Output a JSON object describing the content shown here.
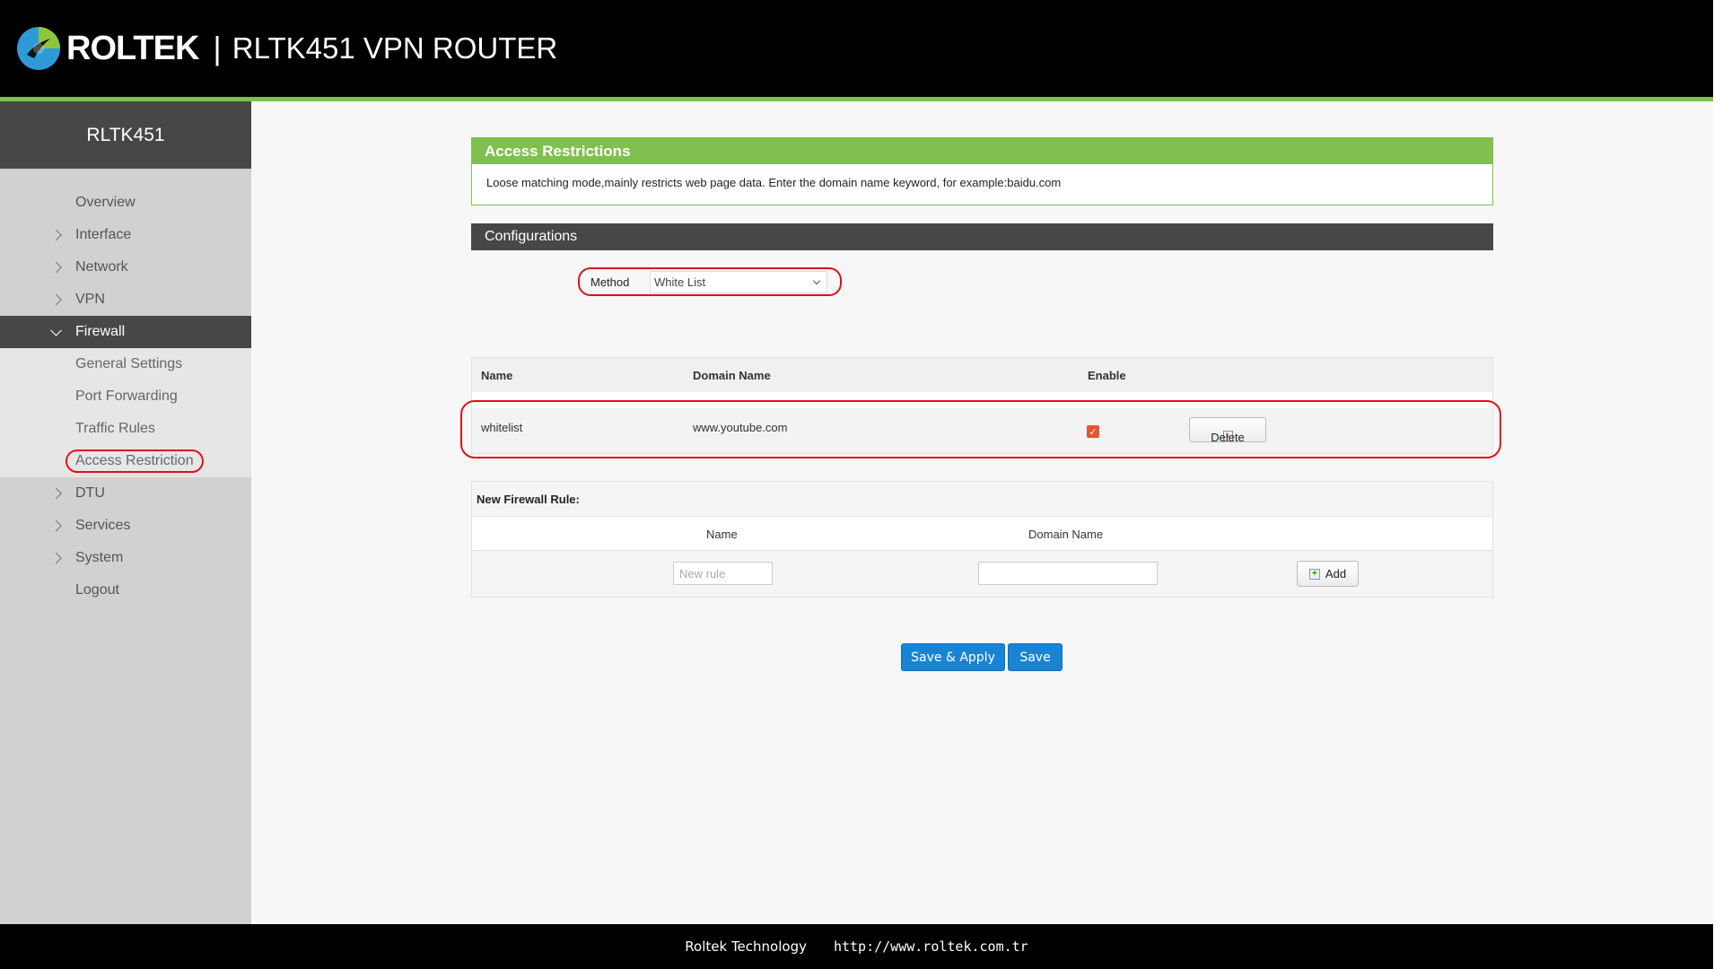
{
  "header": {
    "brand": "ROLTEK",
    "separator": "|",
    "product": "RLTK451 VPN ROUTER"
  },
  "sidebar": {
    "title": "RLTK451",
    "items": [
      {
        "label": "Overview",
        "has_chevron": false
      },
      {
        "label": "Interface",
        "has_chevron": true
      },
      {
        "label": "Network",
        "has_chevron": true
      },
      {
        "label": "VPN",
        "has_chevron": true
      },
      {
        "label": "Firewall",
        "has_chevron": true,
        "active": true
      },
      {
        "label": "DTU",
        "has_chevron": true
      },
      {
        "label": "Services",
        "has_chevron": true
      },
      {
        "label": "System",
        "has_chevron": true
      },
      {
        "label": "Logout",
        "has_chevron": false
      }
    ],
    "firewall_sub": [
      {
        "label": "General Settings"
      },
      {
        "label": "Port Forwarding"
      },
      {
        "label": "Traffic Rules"
      },
      {
        "label": "Access Restriction",
        "selected": true
      }
    ]
  },
  "access_restrictions": {
    "title": "Access Restrictions",
    "description": "Loose matching mode,mainly restricts web page data. Enter the domain name keyword, for example:baidu.com"
  },
  "configurations": {
    "title": "Configurations",
    "method_label": "Method",
    "method_value": "White List"
  },
  "rules_table": {
    "headers": {
      "name": "Name",
      "domain": "Domain Name",
      "enable": "Enable"
    },
    "rows": [
      {
        "name": "whitelist",
        "domain": "www.youtube.com",
        "enabled": true,
        "delete_label": "Delete"
      }
    ]
  },
  "new_rule": {
    "title": "New Firewall Rule:",
    "name_header": "Name",
    "domain_header": "Domain Name",
    "name_placeholder": "New rule",
    "domain_value": "",
    "add_label": "Add"
  },
  "actions": {
    "save_apply": "Save & Apply",
    "save": "Save"
  },
  "footer": {
    "company": "Roltek Technology",
    "url": "http://www.roltek.com.tr"
  },
  "colors": {
    "accent_green": "#80c04e",
    "sidebar_dark": "#474747",
    "primary_blue": "#1a84d4",
    "highlight_red": "#e0101a"
  }
}
